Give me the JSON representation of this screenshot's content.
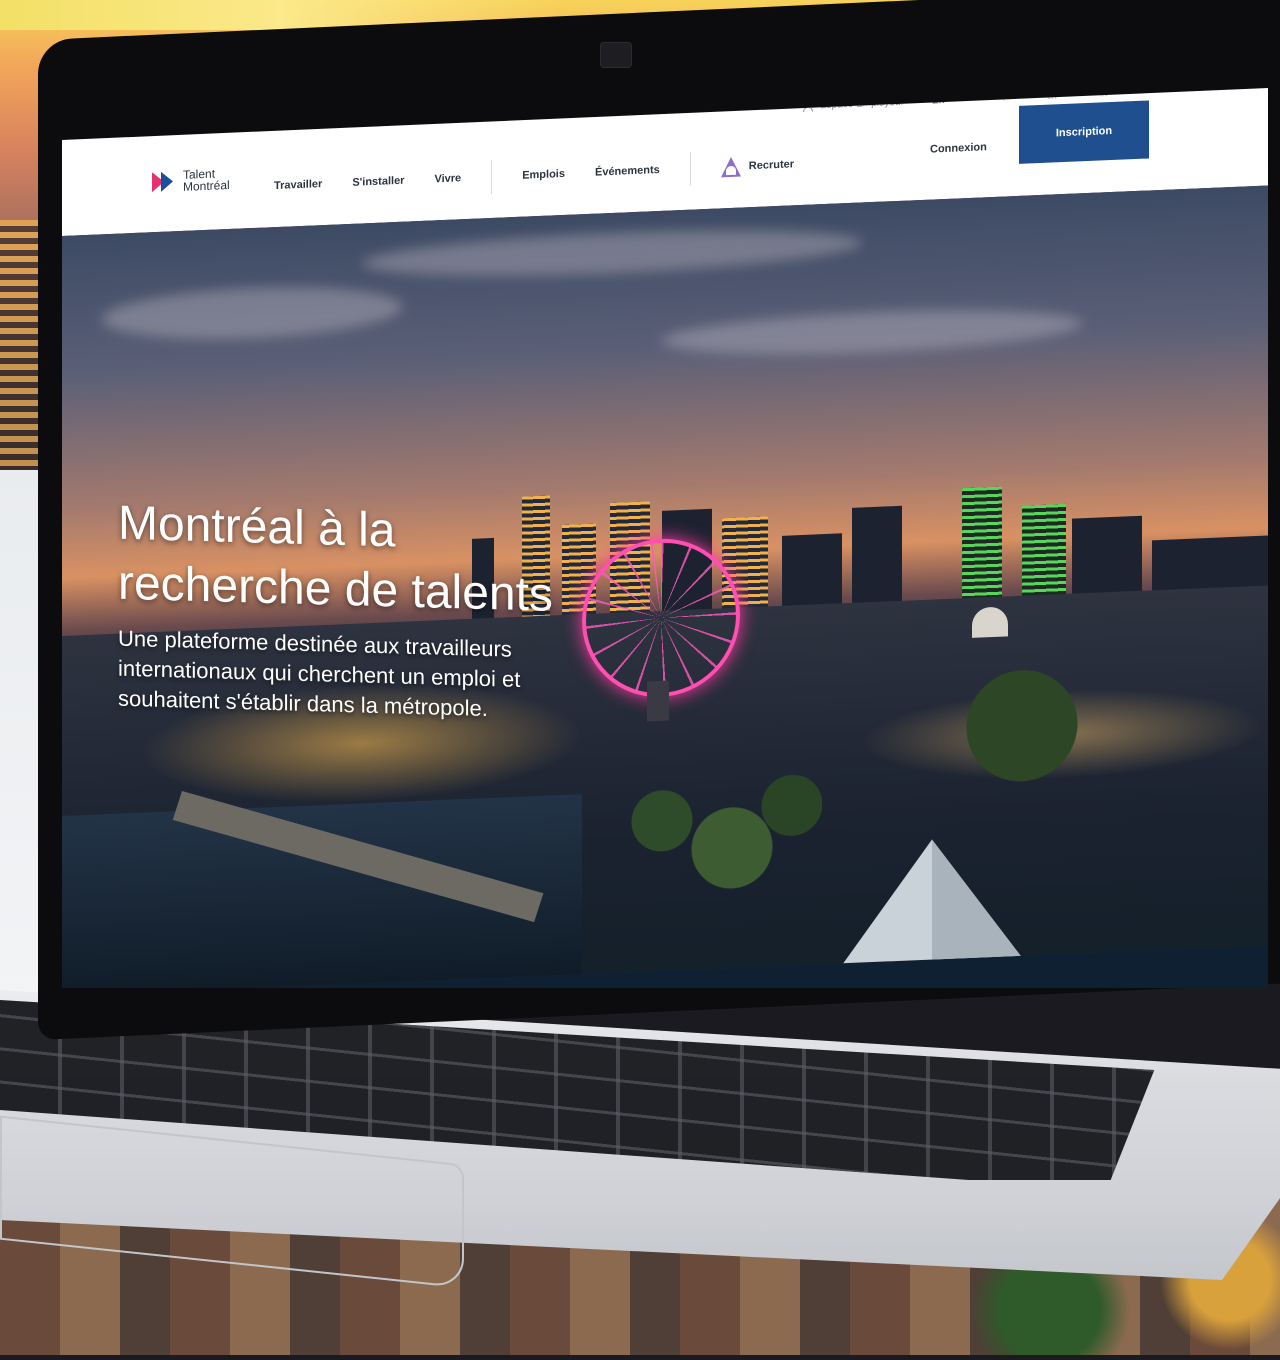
{
  "header": {
    "util": {
      "employer_space": "Espace Employeur",
      "lang": "En",
      "social": [
        "f",
        "tw",
        "in"
      ]
    },
    "logo": {
      "line1": "Talent",
      "line2": "Montréal"
    },
    "nav": {
      "items": [
        "Travailler",
        "S'installer",
        "Vivre"
      ],
      "items2": [
        "Emplois",
        "Événements"
      ],
      "recruit": "Recruter"
    },
    "login": "Connexion",
    "signup": "Inscription"
  },
  "hero": {
    "title_line1": "Montréal à la",
    "title_line2": "recherche de talents",
    "subtitle": "Une plateforme destinée aux travailleurs internationaux qui cherchent un emploi et souhaitent s'établir dans la métropole."
  },
  "colors": {
    "brand_blue": "#1f4f8f",
    "logo_pink": "#e5326f",
    "recruit_purple": "#8f6fc6",
    "wheel_pink": "#ff4fb0"
  }
}
